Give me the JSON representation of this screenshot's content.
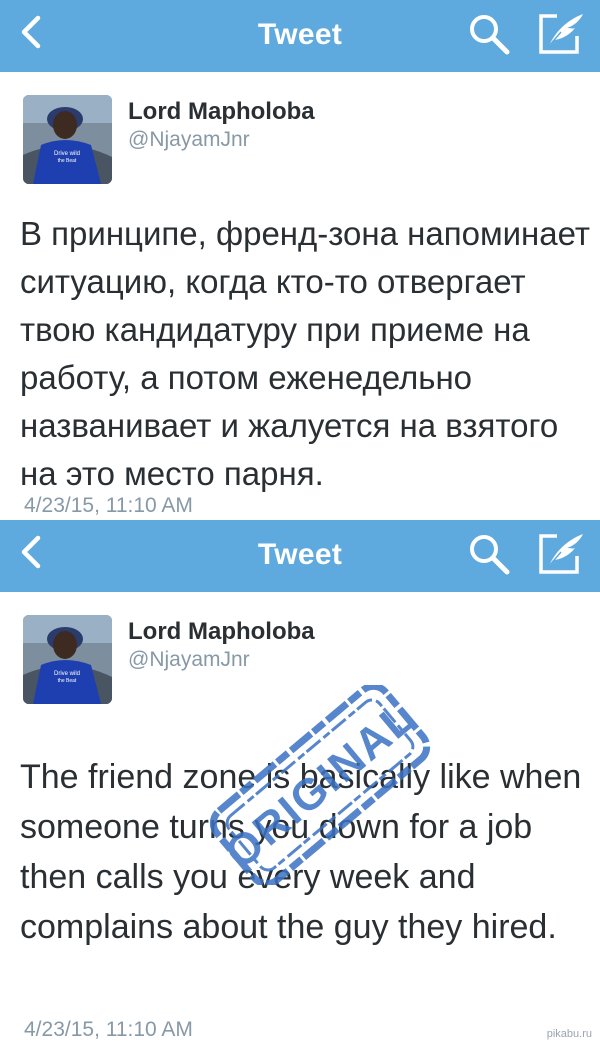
{
  "panels": [
    {
      "nav": {
        "title": "Tweet",
        "back_icon": "chevron-left-icon",
        "search_icon": "search-icon",
        "compose_icon": "compose-quill-icon"
      },
      "tweet": {
        "author_name": "Lord Mapholoba",
        "author_handle": "@NjayamJnr",
        "text": "В принципе, френд-зона напоминает ситуацию, когда кто-то отвергает твою кандидатуру при приеме на работу, а потом еженедельно названивает и жалуется на взятого на это место парня.",
        "timestamp": "4/23/15, 11:10 AM"
      }
    },
    {
      "nav": {
        "title": "Tweet",
        "back_icon": "chevron-left-icon",
        "search_icon": "search-icon",
        "compose_icon": "compose-quill-icon"
      },
      "tweet": {
        "author_name": "Lord Mapholoba",
        "author_handle": "@NjayamJnr",
        "text": "The friend zone is basically like when someone turns you down for a job then calls you every week and complains about the guy they hired.",
        "timestamp": "4/23/15, 11:10 AM"
      },
      "stamp_text": "ORIGINAL"
    }
  ],
  "watermark": "pikabu.ru",
  "colors": {
    "navbar": "#5ea9dd",
    "text": "#292f33",
    "secondary": "#8899a6",
    "stamp": "#3a72c4"
  }
}
